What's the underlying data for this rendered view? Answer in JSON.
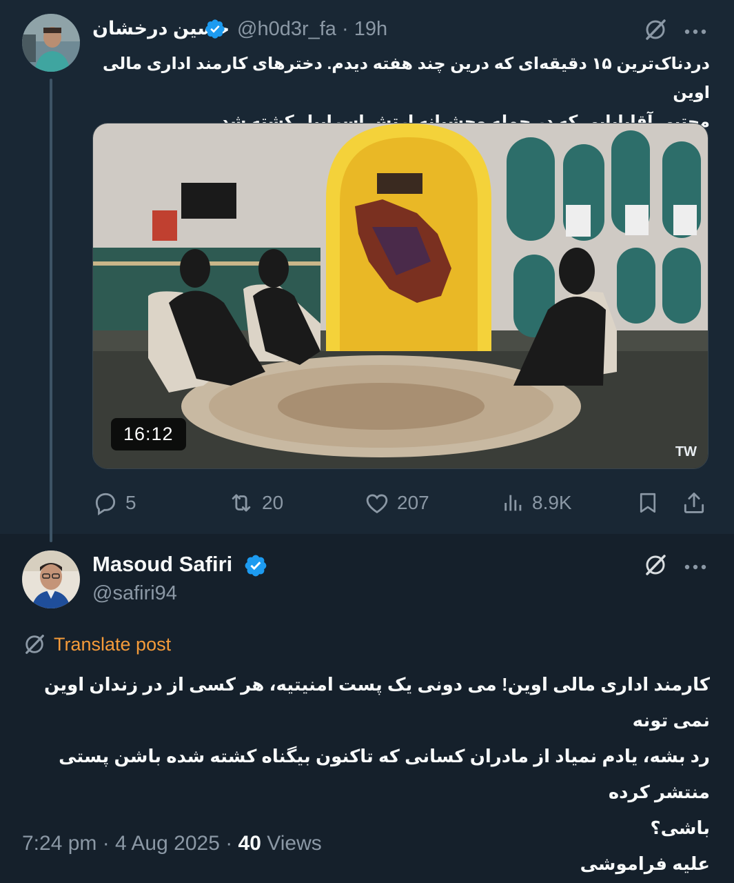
{
  "parent": {
    "author_name": "حسین درخشان",
    "handle": "@h0d3r_fa",
    "time": "19h",
    "text_line1": "دردناک‌ترین ۱۵ دقیقه‌ای که درین چند هفته دیدم. دخترهای کارمند اداری مالی اوین",
    "text_line2": "مجتبی آقابابایی که در حمله وحشیانه ارتش اسراییل کشته شد...",
    "video_duration": "16:12",
    "video_watermark": "TW",
    "stats": {
      "replies": "5",
      "reposts": "20",
      "likes": "207",
      "views": "8.9K"
    }
  },
  "quote": {
    "author_name": "Masoud Safiri",
    "handle": "@safiri94",
    "translate_label": "Translate post",
    "text_line1": "کارمند اداری مالی اوین! می دونی یک پست امنیتیه، هر کسی از در زندان اوین نمی تونه",
    "text_line2": "رد بشه، یادم نمیاد از مادران کسانی که تاکنون بیگناه کشته شده باشن پستی منتشر کرده",
    "text_line3": "باشی؟",
    "text_line4": "علیه فراموشی",
    "timestamp": "7:24 pm · 4 Aug 2025 · ",
    "views_count": "40",
    "views_label": "Views"
  },
  "icons": {
    "verified": "verified-badge-icon",
    "grok": "grok-icon",
    "more": "more-icon",
    "reply": "reply-icon",
    "repost": "repost-icon",
    "like": "heart-icon",
    "views": "views-chart-icon",
    "bookmark": "bookmark-icon",
    "share": "share-icon"
  },
  "colors": {
    "accent": "#1d9bf0",
    "translate": "#f59b3a",
    "background": "#15202b",
    "muted": "#8b98a5"
  }
}
